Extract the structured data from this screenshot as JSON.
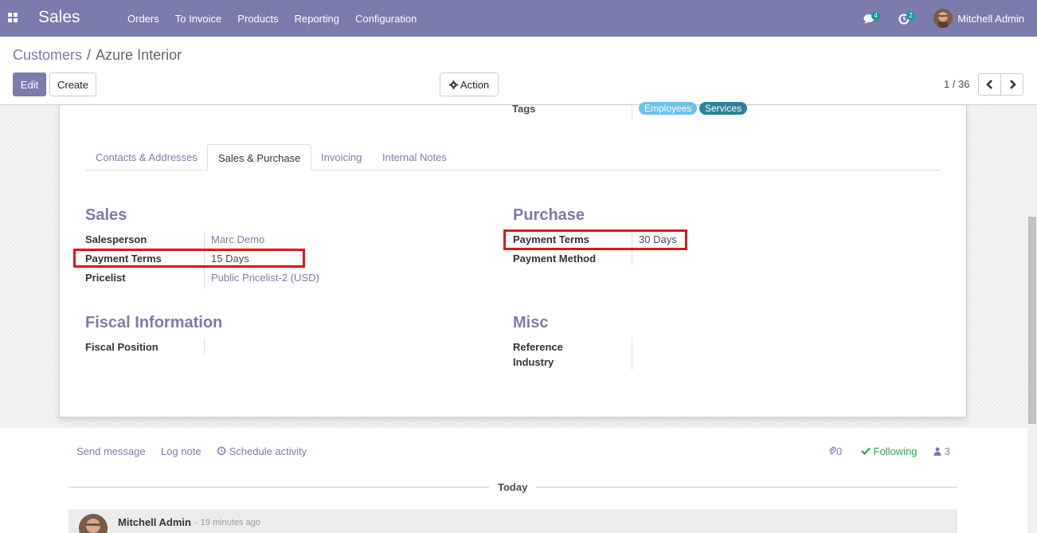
{
  "navbar": {
    "app_name": "Sales",
    "menu": [
      "Orders",
      "To Invoice",
      "Products",
      "Reporting",
      "Configuration"
    ],
    "messages_count": "4",
    "activities_count": "2",
    "user_name": "Mitchell Admin",
    "color": "#7c7bad"
  },
  "control": {
    "breadcrumb_parent": "Customers",
    "breadcrumb_separator": "/",
    "breadcrumb_current": "Azure Interior",
    "edit_label": "Edit",
    "create_label": "Create",
    "action_label": "Action",
    "pager": "1 / 36"
  },
  "header_fields": {
    "tags_label": "Tags",
    "tags": [
      {
        "label": "Employees",
        "color": "#6cc1ed"
      },
      {
        "label": "Services",
        "color": "#2c8397"
      }
    ]
  },
  "tabs": [
    "Contacts & Addresses",
    "Sales & Purchase",
    "Invoicing",
    "Internal Notes"
  ],
  "active_tab": "Sales & Purchase",
  "sales": {
    "title": "Sales",
    "salesperson_label": "Salesperson",
    "salesperson_value": "Marc Demo",
    "payment_terms_label": "Payment Terms",
    "payment_terms_value": "15 Days",
    "pricelist_label": "Pricelist",
    "pricelist_value": "Public Pricelist-2 (USD)"
  },
  "purchase": {
    "title": "Purchase",
    "payment_terms_label": "Payment Terms",
    "payment_terms_value": "30 Days",
    "payment_method_label": "Payment Method"
  },
  "fiscal": {
    "title": "Fiscal Information",
    "fiscal_position_label": "Fiscal Position"
  },
  "misc": {
    "title": "Misc",
    "reference_label": "Reference",
    "industry_label": "Industry"
  },
  "chatter": {
    "send_message": "Send message",
    "log_note": "Log note",
    "schedule_activity": "Schedule activity",
    "attachments_count": "0",
    "following_label": "Following",
    "followers_count": "3",
    "today_label": "Today",
    "message_author": "Mitchell Admin",
    "message_time": "- 19 minutes ago"
  },
  "highlight_color": "#e0151b"
}
